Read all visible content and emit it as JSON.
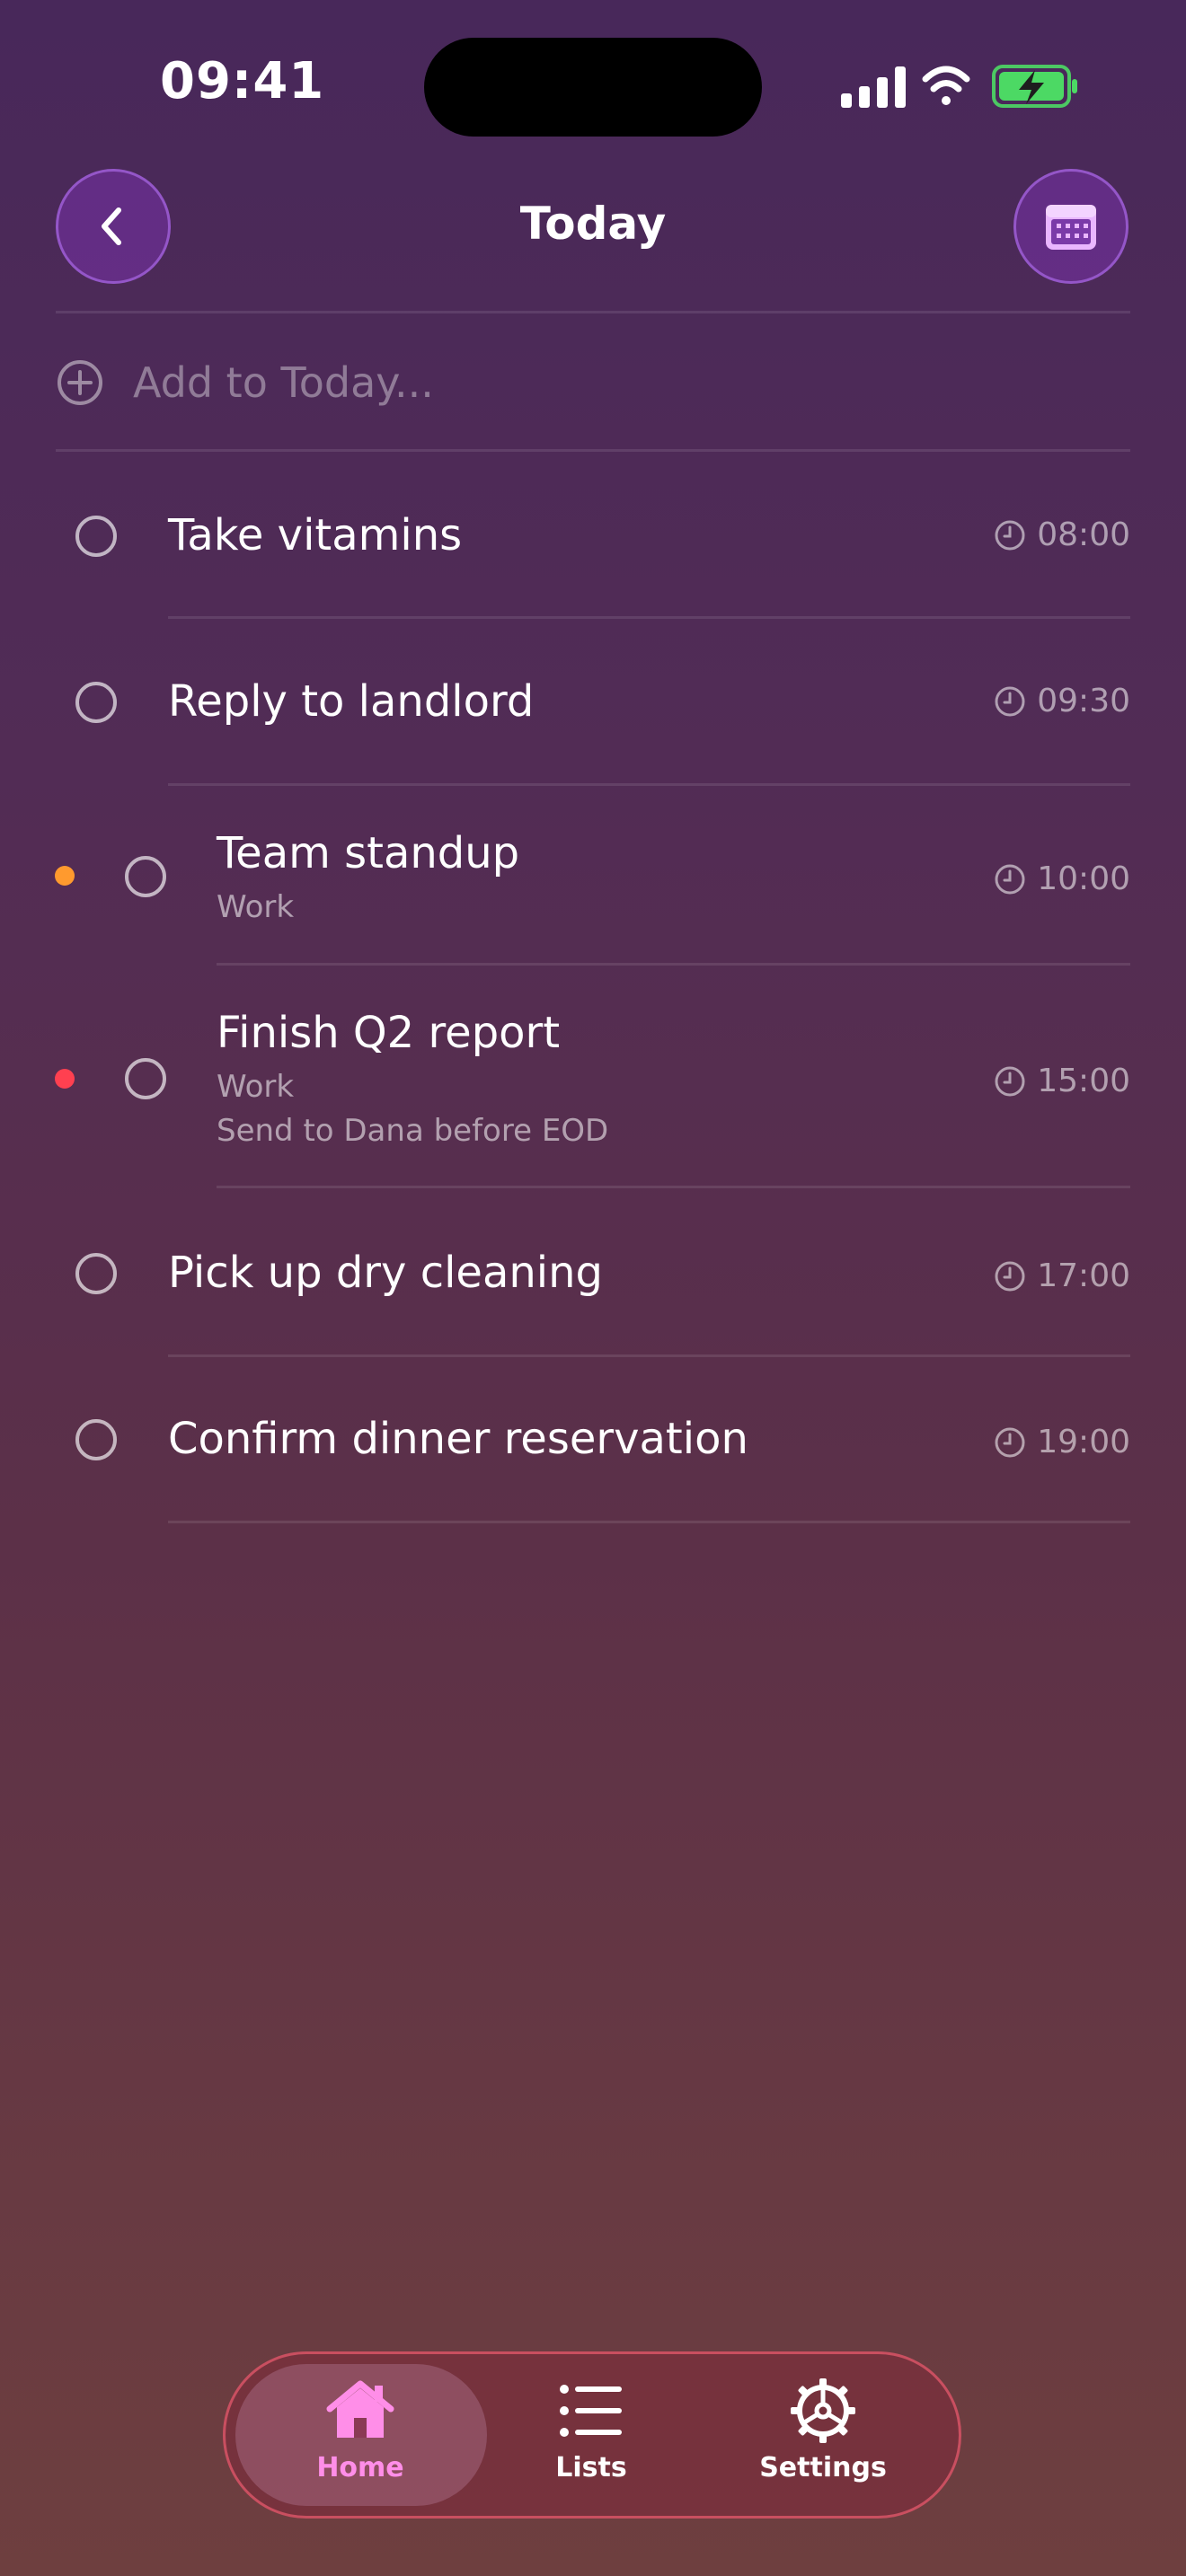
{
  "status_bar": {
    "time": "09:41",
    "icons": [
      "signal-icon",
      "wifi-icon",
      "battery-charging-icon"
    ],
    "battery_color": "#4cd964"
  },
  "header": {
    "title": "Today",
    "back_icon": "chevron-left-icon",
    "calendar_icon": "calendar-icon"
  },
  "add_task": {
    "placeholder": "Add to Today..."
  },
  "tasks": [
    {
      "title": "Take vitamins",
      "time": "08:00"
    },
    {
      "title": "Reply to landlord",
      "time": "09:30"
    },
    {
      "title": "Team standup",
      "subtitle": "Work",
      "time": "10:00",
      "priority_color": "#ff9a2e"
    },
    {
      "title": "Finish Q2 report",
      "subtitle": "Work",
      "note": "Send to Dana before EOD",
      "time": "15:00",
      "priority_color": "#ff4050"
    },
    {
      "title": "Pick up dry cleaning",
      "time": "17:00"
    },
    {
      "title": "Confirm dinner reservation",
      "time": "19:00"
    }
  ],
  "tab_bar": {
    "tabs": [
      {
        "label": "Home",
        "icon": "home-icon",
        "active": true
      },
      {
        "label": "Lists",
        "icon": "list-icon",
        "active": false
      },
      {
        "label": "Settings",
        "icon": "gear-icon",
        "active": false
      }
    ],
    "active_color": "#ff8ee8"
  }
}
